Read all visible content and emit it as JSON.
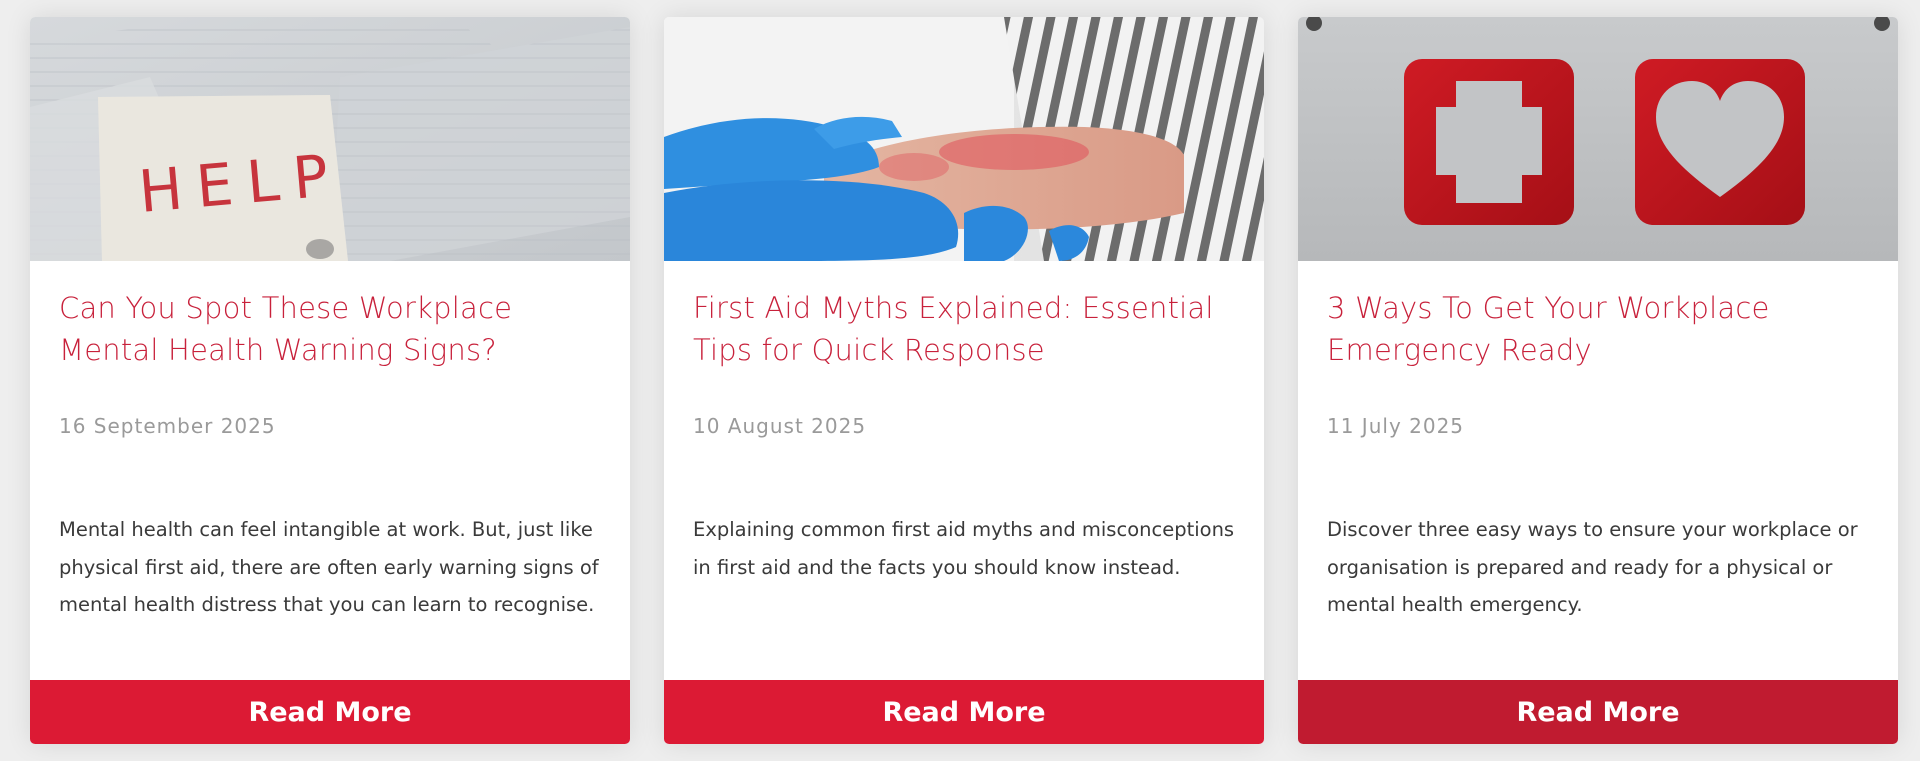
{
  "theme": {
    "title_color": "#c8213b",
    "date_color": "#9a9a9a",
    "text_color": "#3a3a3a"
  },
  "cards": [
    {
      "image_icon": "help-note-icon",
      "image_text": "HELP",
      "title": "Can You Spot These Workplace Mental Health Warning Signs?",
      "date": "16 September 2025",
      "excerpt": "Mental health can feel intangible at work. But, just like physical first aid, there are often early warning signs of mental health distress that you can learn to recognise.",
      "button_label": "Read More",
      "button_color": "#dc1a34"
    },
    {
      "image_icon": "gloved-hands-arm-icon",
      "title": "First Aid Myths Explained: Essential Tips for Quick Response",
      "date": "10 August 2025",
      "excerpt": "Explaining common first aid myths and misconceptions in first aid and the facts you should know instead.",
      "button_label": "Read More",
      "button_color": "#dc1a34"
    },
    {
      "image_icon": "first-aid-cross-heart-icon",
      "title": "3 Ways To Get Your Workplace Emergency Ready",
      "date": "11 July 2025",
      "excerpt": "Discover three easy ways to ensure your workplace or organisation is prepared and ready for a physical or mental health emergency.",
      "button_label": "Read More",
      "button_color": "#c01b30"
    }
  ]
}
